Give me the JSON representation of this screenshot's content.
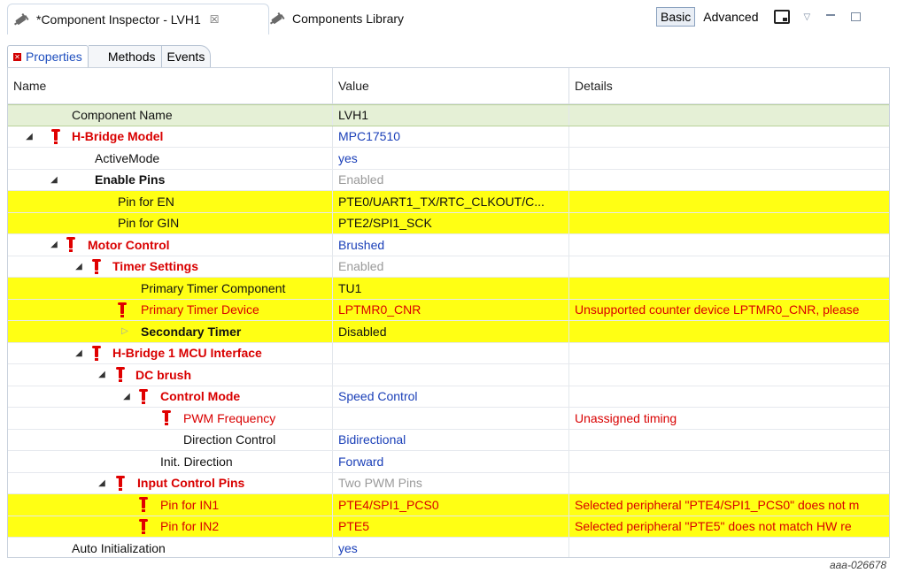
{
  "tabs": {
    "inspector_title": "*Component Inspector - LVH1",
    "inspector_close": "☒",
    "library_title": "Components Library"
  },
  "modes": {
    "basic": "Basic",
    "advanced": "Advanced"
  },
  "subtabs": {
    "properties": "Properties",
    "methods": "Methods",
    "events": "Events"
  },
  "columns": {
    "name": "Name",
    "value": "Value",
    "details": "Details"
  },
  "rows": [
    {
      "name": "Component Name",
      "value": "LVH1",
      "details": ""
    },
    {
      "name": "H-Bridge Model",
      "value": "MPC17510",
      "details": ""
    },
    {
      "name": "ActiveMode",
      "value": "yes",
      "details": ""
    },
    {
      "name": "Enable Pins",
      "value": "Enabled",
      "details": ""
    },
    {
      "name": "Pin for EN",
      "value": "PTE0/UART1_TX/RTC_CLKOUT/C...",
      "details": ""
    },
    {
      "name": "Pin for GIN",
      "value": "PTE2/SPI1_SCK",
      "details": ""
    },
    {
      "name": "Motor Control",
      "value": "Brushed",
      "details": ""
    },
    {
      "name": "Timer Settings",
      "value": "Enabled",
      "details": ""
    },
    {
      "name": "Primary Timer Component",
      "value": "TU1",
      "details": ""
    },
    {
      "name": "Primary Timer Device",
      "value": "LPTMR0_CNR",
      "details": "Unsupported counter device LPTMR0_CNR, please"
    },
    {
      "name": "Secondary Timer",
      "value": "Disabled",
      "details": ""
    },
    {
      "name": "H-Bridge 1 MCU Interface",
      "value": "",
      "details": ""
    },
    {
      "name": "DC brush",
      "value": "",
      "details": ""
    },
    {
      "name": "Control Mode",
      "value": "Speed Control",
      "details": ""
    },
    {
      "name": "PWM Frequency",
      "value": "",
      "details": "Unassigned timing"
    },
    {
      "name": "Direction Control",
      "value": "Bidirectional",
      "details": ""
    },
    {
      "name": "Init. Direction",
      "value": "Forward",
      "details": ""
    },
    {
      "name": "Input Control Pins",
      "value": "Two PWM Pins",
      "details": ""
    },
    {
      "name": "Pin for IN1",
      "value": "PTE4/SPI1_PCS0",
      "details": "Selected peripheral \"PTE4/SPI1_PCS0\" does not m"
    },
    {
      "name": "Pin for IN2",
      "value": "PTE5",
      "details": "Selected peripheral \"PTE5\" does not match HW re"
    },
    {
      "name": "Auto Initialization",
      "value": "yes",
      "details": ""
    }
  ],
  "footnote": "aaa-026678",
  "colors": {
    "highlight": "#ffff14",
    "error": "#d90000",
    "value_blue": "#1a3fb8",
    "selected": "#e5f0d6"
  }
}
